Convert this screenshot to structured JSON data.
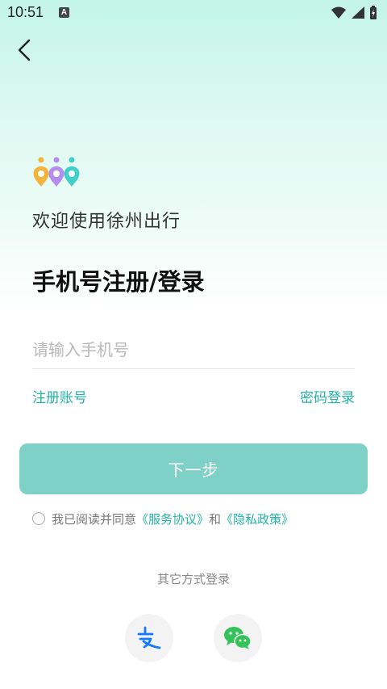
{
  "status": {
    "time": "10:51",
    "badge": "A"
  },
  "header": {
    "back_icon": "chevron-left-icon"
  },
  "welcome": "欢迎使用徐州出行",
  "title": "手机号注册/登录",
  "phone_input": {
    "placeholder": "请输入手机号",
    "value": ""
  },
  "links": {
    "register": "注册账号",
    "password_login": "密码登录"
  },
  "next_button": "下一步",
  "agreement": {
    "prefix": "我已阅读并同意",
    "service": "《服务协议》",
    "and": "和",
    "privacy": "《隐私政策》"
  },
  "other_login": {
    "title": "其它方式登录",
    "methods": [
      "alipay-icon",
      "wechat-icon"
    ]
  },
  "colors": {
    "accent": "#22b3a6",
    "button": "#7fd0c6",
    "gradient_top": "#c3f5e6"
  }
}
